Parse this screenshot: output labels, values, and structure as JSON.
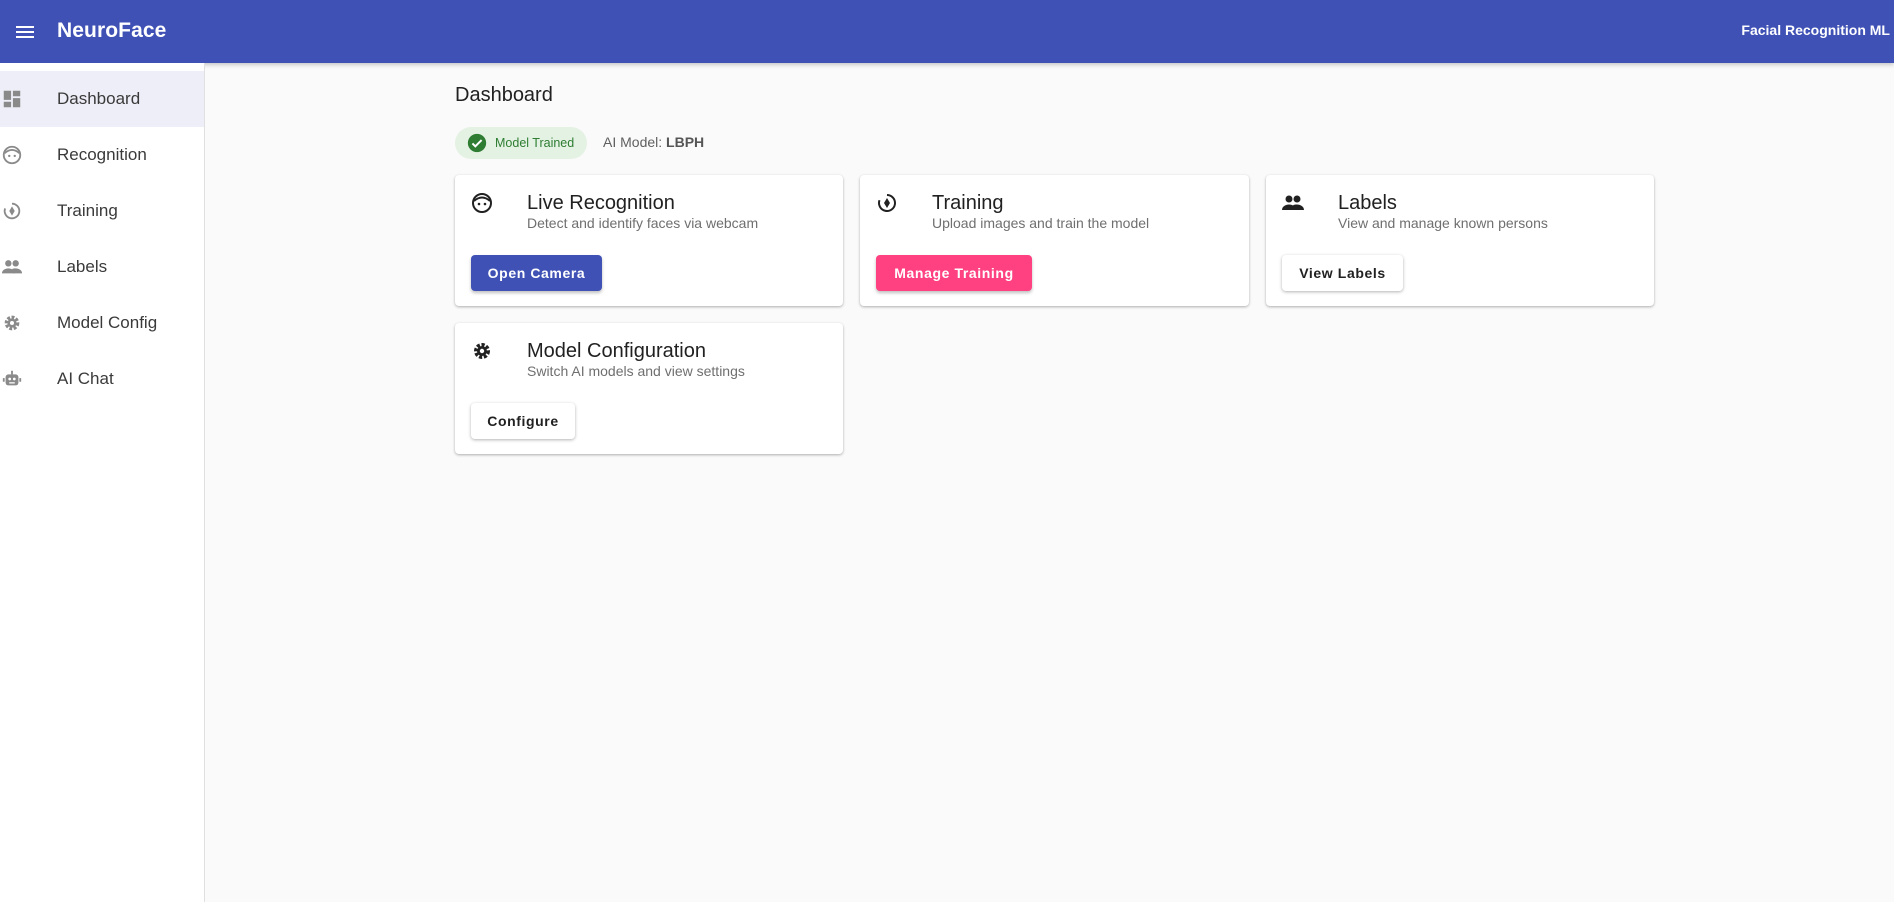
{
  "appbar": {
    "menu_icon": "menu-icon",
    "title": "NeuroFace",
    "right_text": "Facial Recognition ML"
  },
  "sidebar": {
    "items": [
      {
        "label": "Dashboard",
        "icon": "dashboard-icon",
        "active": true
      },
      {
        "label": "Recognition",
        "icon": "face-icon",
        "active": false
      },
      {
        "label": "Training",
        "icon": "training-icon",
        "active": false
      },
      {
        "label": "Labels",
        "icon": "people-icon",
        "active": false
      },
      {
        "label": "Model Config",
        "icon": "gear-icon",
        "active": false
      },
      {
        "label": "AI Chat",
        "icon": "robot-icon",
        "active": false
      }
    ]
  },
  "main": {
    "title": "Dashboard",
    "status_chip": {
      "label": "Model Trained",
      "icon": "check-circle-icon"
    },
    "model_info": {
      "prefix": "AI Model:",
      "value": "LBPH"
    },
    "cards": [
      {
        "title": "Live Recognition",
        "subtitle": "Detect and identify faces via webcam",
        "button": "Open Camera",
        "icon": "face-icon"
      },
      {
        "title": "Training",
        "subtitle": "Upload images and train the model",
        "button": "Manage Training",
        "icon": "training-icon"
      },
      {
        "title": "Labels",
        "subtitle": "View and manage known persons",
        "button": "View Labels",
        "icon": "people-icon"
      },
      {
        "title": "Model Configuration",
        "subtitle": "Switch AI models and view settings",
        "button": "Configure",
        "icon": "gear-icon"
      }
    ]
  },
  "colors": {
    "primary": "#3f51b5",
    "secondary": "#ff4081",
    "success": "#2e7d32",
    "success_bg": "#e4f2e4",
    "active_nav_bg": "#eeeef8"
  }
}
